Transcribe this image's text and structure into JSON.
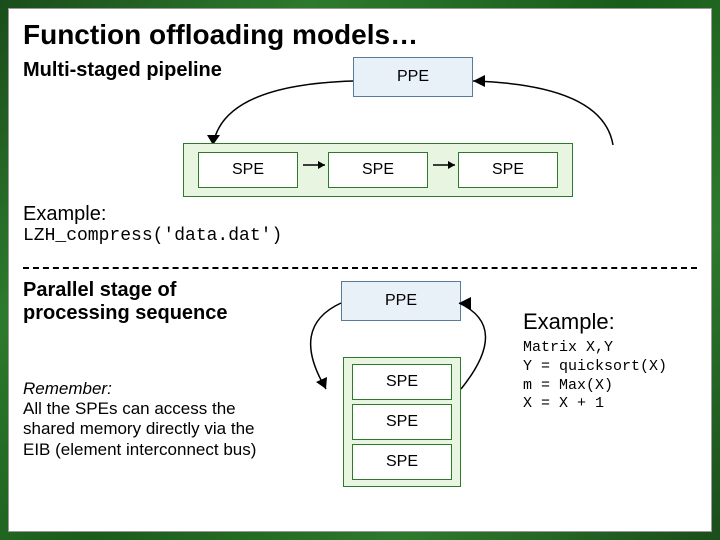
{
  "title": "Function offloading models…",
  "section1": {
    "label": "Multi-staged pipeline",
    "ppe": "PPE",
    "spe": [
      "SPE",
      "SPE",
      "SPE"
    ],
    "exampleLabel": "Example:",
    "exampleCode": "LZH_compress('data.dat')"
  },
  "section2": {
    "label": "Parallel stage of processing sequence",
    "rememberLabel": "Remember:",
    "rememberText": "All the SPEs can access the shared memory directly via the EIB (element interconnect bus)",
    "ppe": "PPE",
    "spe": [
      "SPE",
      "SPE",
      "SPE"
    ],
    "exampleLabel": "Example:",
    "exampleCode": [
      "Matrix X,Y",
      "Y = quicksort(X)",
      "m = Max(X)",
      "X = X + 1"
    ]
  }
}
